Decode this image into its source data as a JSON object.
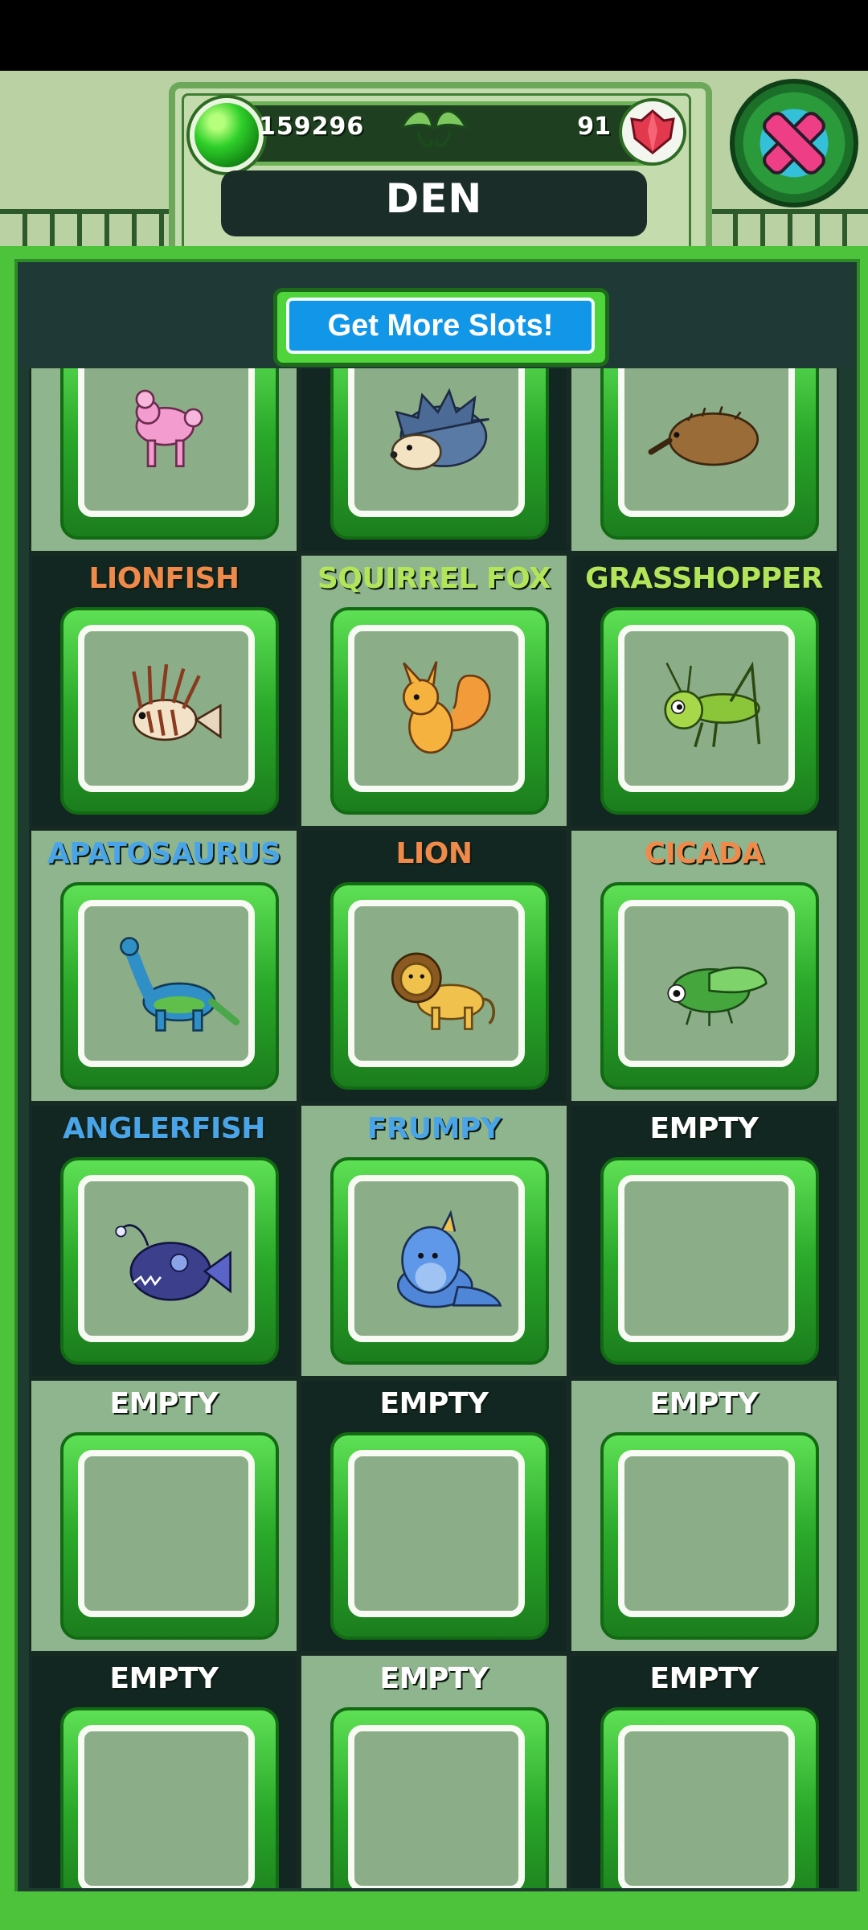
{
  "header": {
    "coins": "159296",
    "gems": "91",
    "title": "DEN"
  },
  "toolbar": {
    "get_more_slots": "Get More Slots!"
  },
  "colors": {
    "label_orange": "#f08a4b",
    "label_green": "#b2e55a",
    "label_blue": "#4aa5e8",
    "label_white": "#ffffff"
  },
  "slots": [
    {
      "label": "",
      "creature": "poodle",
      "color": "#ffffff"
    },
    {
      "label": "",
      "creature": "hedgehog",
      "color": "#ffffff"
    },
    {
      "label": "",
      "creature": "echidna",
      "color": "#ffffff"
    },
    {
      "label": "LIONFISH",
      "creature": "lionfish",
      "color": "#f08a4b"
    },
    {
      "label": "SQUIRREL FOX",
      "creature": "squirrel-fox",
      "color": "#b2e55a"
    },
    {
      "label": "GRASSHOPPER",
      "creature": "grasshopper",
      "color": "#b2e55a"
    },
    {
      "label": "APATOSAURUS",
      "creature": "apatosaurus",
      "color": "#4aa5e8"
    },
    {
      "label": "LION",
      "creature": "lion",
      "color": "#f08a4b"
    },
    {
      "label": "CICADA",
      "creature": "cicada",
      "color": "#f08a4b"
    },
    {
      "label": "ANGLERFISH",
      "creature": "anglerfish",
      "color": "#4aa5e8"
    },
    {
      "label": "FRUMPY",
      "creature": "frumpy",
      "color": "#4aa5e8"
    },
    {
      "label": "EMPTY",
      "creature": "",
      "color": "#ffffff"
    },
    {
      "label": "EMPTY",
      "creature": "",
      "color": "#ffffff"
    },
    {
      "label": "EMPTY",
      "creature": "",
      "color": "#ffffff"
    },
    {
      "label": "EMPTY",
      "creature": "",
      "color": "#ffffff"
    },
    {
      "label": "EMPTY",
      "creature": "",
      "color": "#ffffff"
    },
    {
      "label": "EMPTY",
      "creature": "",
      "color": "#ffffff"
    },
    {
      "label": "EMPTY",
      "creature": "",
      "color": "#ffffff"
    }
  ]
}
